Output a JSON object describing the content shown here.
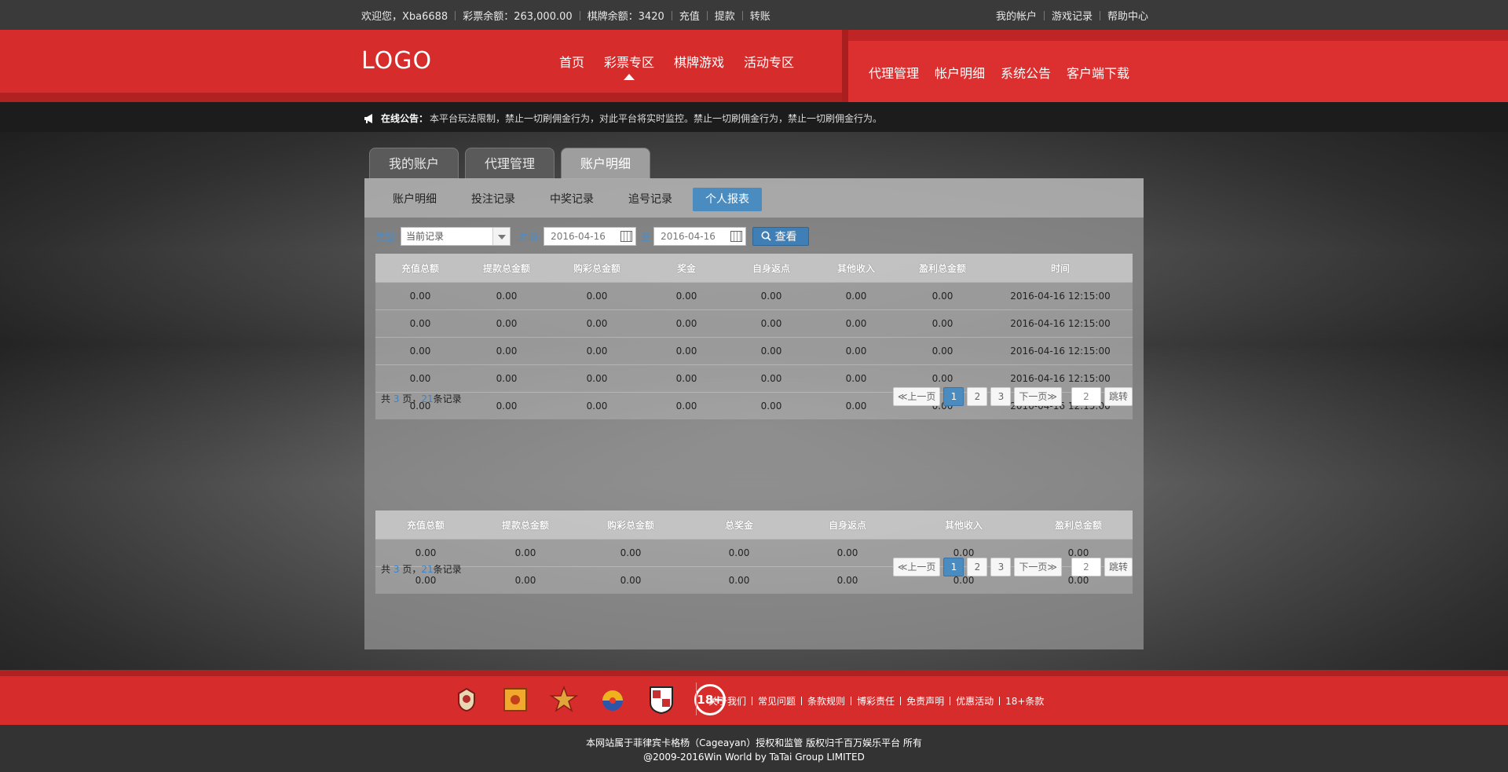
{
  "topbar": {
    "welcome": "欢迎您，Xba6688",
    "lottery_balance": "彩票余额：263,000.00",
    "chess_balance": "棋牌余额：3420",
    "recharge": "充值",
    "withdraw": "提款",
    "transfer": "转账",
    "my_account": "我的帐户",
    "game_records": "游戏记录",
    "help_center": "帮助中心"
  },
  "header": {
    "logo": "LOGO",
    "nav_main": [
      "首页",
      "彩票专区",
      "棋牌游戏",
      "活动专区"
    ],
    "nav_right": [
      "代理管理",
      "帐户明细",
      "系统公告",
      "客户端下载"
    ]
  },
  "notice": {
    "label": "在线公告：",
    "text": "本平台玩法限制，禁止一切刷佣金行为，对此平台将实时监控。禁止一切刷佣金行为，禁止一切刷佣金行为。"
  },
  "tabs": [
    "我的账户",
    "代理管理",
    "账户明细"
  ],
  "subtabs": [
    "账户明细",
    "投注记录",
    "中奖记录",
    "追号记录",
    "个人报表"
  ],
  "filter": {
    "type_label": "类型:",
    "type_value": "当前记录",
    "time_label": "时间:",
    "date_from": "2016-04-16",
    "to_label": "至",
    "date_to": "2016-04-16",
    "search_button": "查看"
  },
  "table1": {
    "headers": [
      "充值总额",
      "提款总金额",
      "购彩总金额",
      "奖金",
      "自身返点",
      "其他收入",
      "盈利总金额",
      "时间"
    ],
    "rows": [
      [
        "0.00",
        "0.00",
        "0.00",
        "0.00",
        "0.00",
        "0.00",
        "0.00",
        "2016-04-16 12:15:00"
      ],
      [
        "0.00",
        "0.00",
        "0.00",
        "0.00",
        "0.00",
        "0.00",
        "0.00",
        "2016-04-16 12:15:00"
      ],
      [
        "0.00",
        "0.00",
        "0.00",
        "0.00",
        "0.00",
        "0.00",
        "0.00",
        "2016-04-16 12:15:00"
      ],
      [
        "0.00",
        "0.00",
        "0.00",
        "0.00",
        "0.00",
        "0.00",
        "0.00",
        "2016-04-16 12:15:00"
      ],
      [
        "0.00",
        "0.00",
        "0.00",
        "0.00",
        "0.00",
        "0.00",
        "0.00",
        "2016-04-16 12:15:00"
      ]
    ]
  },
  "table2": {
    "headers": [
      "充值总额",
      "提款总金额",
      "购彩总金额",
      "总奖金",
      "自身返点",
      "其他收入",
      "盈利总金额"
    ],
    "rows": [
      [
        "0.00",
        "0.00",
        "0.00",
        "0.00",
        "0.00",
        "0.00",
        "0.00"
      ],
      [
        "0.00",
        "0.00",
        "0.00",
        "0.00",
        "0.00",
        "0.00",
        "0.00"
      ]
    ]
  },
  "pager": {
    "prefix": "共",
    "pages": "3",
    "mid": "页，",
    "records": "21",
    "suffix": "条记录",
    "prev": "≪上一页",
    "next": "下一页≫",
    "page_numbers": [
      "1",
      "2",
      "3"
    ],
    "jump_value": "2",
    "jump": "跳转"
  },
  "footer": {
    "badge": "18+",
    "links": [
      "关于我们",
      "常见问题",
      "条款规则",
      "博彩责任",
      "免责声明",
      "优惠活动",
      "18+条款"
    ],
    "copyright1": "本网站属于菲律宾卡格杨（Cageayan）授权和监管 版权归千百万娱乐平台 所有",
    "copyright2": "@2009-2016Win World by TaTai Group LIMITED"
  }
}
